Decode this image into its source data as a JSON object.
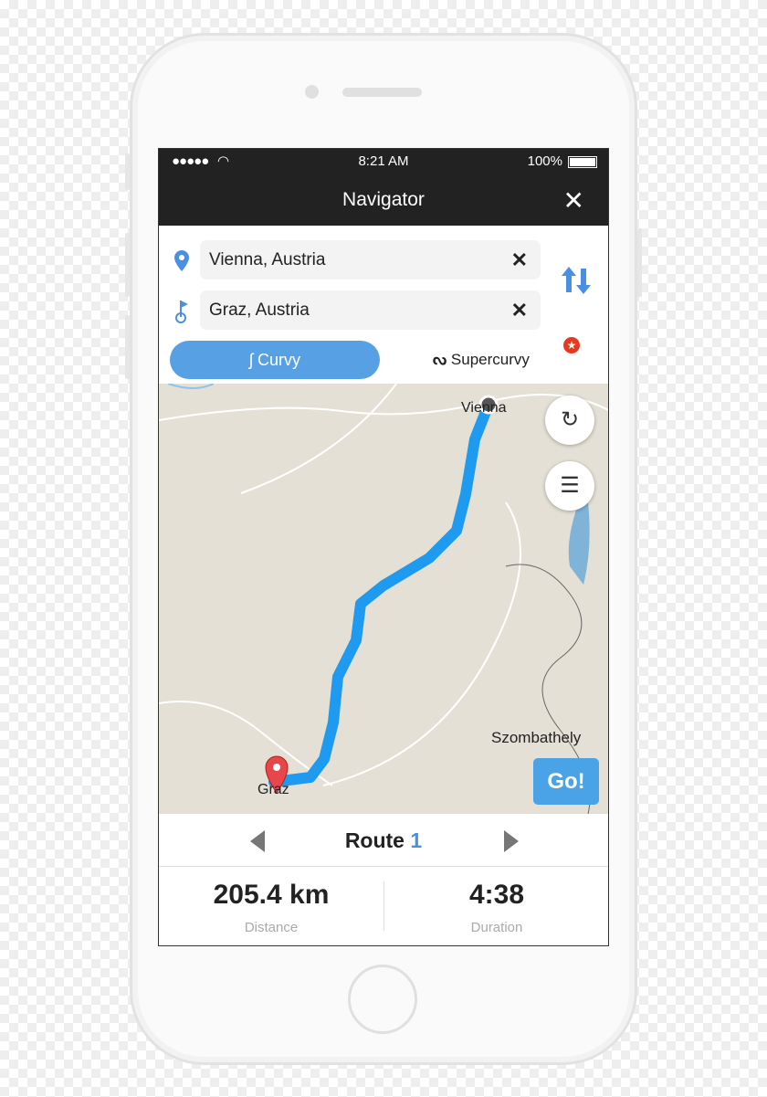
{
  "status": {
    "time": "8:21 AM",
    "battery": "100%"
  },
  "header": {
    "title": "Navigator"
  },
  "route_inputs": {
    "origin": "Vienna, Austria",
    "destination": "Graz, Austria"
  },
  "modes": {
    "curvy": "Curvy",
    "supercurvy": "Supercurvy",
    "supercurvy_badge": "★"
  },
  "map": {
    "labels": {
      "vienna": "Vienna",
      "graz": "Graz",
      "szombathely": "Szombathely"
    },
    "route_color": "#1e9bf0",
    "go_label": "Go!"
  },
  "route_selector": {
    "label": "Route",
    "number": "1"
  },
  "stats": {
    "distance": "205.4 km",
    "distance_label": "Distance",
    "duration": "4:38",
    "duration_label": "Duration"
  },
  "colors": {
    "accent": "#58a0e4",
    "header": "#222222"
  }
}
